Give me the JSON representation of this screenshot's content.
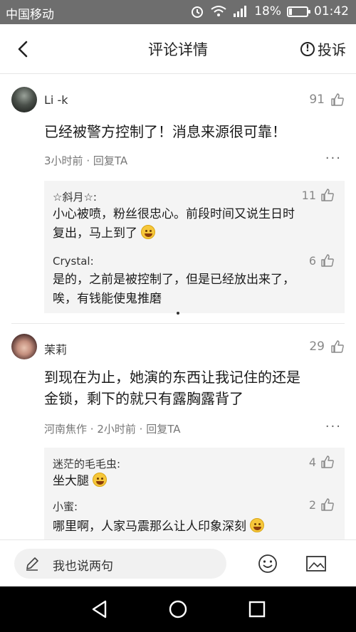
{
  "status_bar": {
    "carrier": "中国移动",
    "battery": "18%",
    "battery_level": 0.18,
    "time": "01:42"
  },
  "header": {
    "title": "评论详情",
    "report_label": "投诉"
  },
  "comments": [
    {
      "username": "Li -k",
      "likes": "91",
      "text": "已经被警方控制了！消息来源很可靠！",
      "time": "3小时前",
      "reply_label": "回复TA",
      "more": "···",
      "replies": [
        {
          "name": "☆斜月☆:",
          "likes": "11",
          "line1": "小心被喷，粉丝很忠心。前段时间又说生日时",
          "line2": "复出，马上到了"
        },
        {
          "name": "Crystal:",
          "likes": "6",
          "line1": "是的，之前是被控制了，但是已经放出来了，",
          "line2": "唉，有钱能使鬼推磨"
        }
      ]
    },
    {
      "username": "茉莉",
      "likes": "29",
      "line1": "到现在为止，她演的东西让我记住的还是",
      "line2": "金锁，剩下的就只有露胸露背了",
      "location": "河南焦作",
      "time": "2小时前",
      "reply_label": "回复TA",
      "more": "···",
      "replies": [
        {
          "name": "迷茫的毛毛虫:",
          "likes": "4",
          "line1": "坐大腿"
        },
        {
          "name": "小蜜:",
          "likes": "2",
          "line1": "哪里啊，人家马震那么让人印象深刻"
        }
      ]
    }
  ],
  "input": {
    "placeholder": "我也说两句"
  },
  "icons": {
    "back": "chevron-left-icon",
    "report": "exclamation-circle-icon",
    "like": "thumbs-up-icon",
    "pen": "pen-icon",
    "emoji": "smiley-icon",
    "image": "image-icon",
    "nav_back": "triangle-back-icon",
    "nav_home": "circle-home-icon",
    "nav_recent": "square-recent-icon"
  }
}
